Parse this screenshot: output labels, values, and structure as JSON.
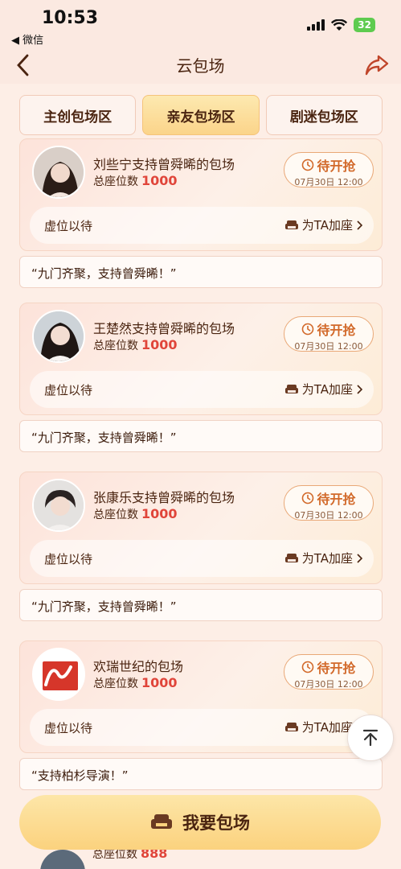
{
  "status": {
    "time": "10:53",
    "back_app": "◀ 微信",
    "battery": "32"
  },
  "nav": {
    "title": "云包场"
  },
  "tabs": [
    {
      "label": "主创包场区",
      "active": false
    },
    {
      "label": "亲友包场区",
      "active": true
    },
    {
      "label": "剧迷包场区",
      "active": false
    }
  ],
  "cards": [
    {
      "title": "刘些宁支持曾舜晞的包场",
      "seats_label": "总座位数",
      "seats": "1000",
      "status": "待开抢",
      "date": "07月30日 12:00",
      "waiting": "虚位以待",
      "action": "为TA加座",
      "slogan": "“九门齐聚，支持曾舜晞！”"
    },
    {
      "title": "王楚然支持曾舜晞的包场",
      "seats_label": "总座位数",
      "seats": "1000",
      "status": "待开抢",
      "date": "07月30日 12:00",
      "waiting": "虚位以待",
      "action": "为TA加座",
      "slogan": "“九门齐聚，支持曾舜晞！”"
    },
    {
      "title": "张康乐支持曾舜晞的包场",
      "seats_label": "总座位数",
      "seats": "1000",
      "status": "待开抢",
      "date": "07月30日 12:00",
      "waiting": "虚位以待",
      "action": "为TA加座",
      "slogan": "“九门齐聚，支持曾舜晞！”"
    },
    {
      "title": "欢瑞世纪的包场",
      "seats_label": "总座位数",
      "seats": "1000",
      "status": "待开抢",
      "date": "07月30日 12:00",
      "waiting": "虚位以待",
      "action": "为TA加座",
      "slogan": "“支持柏杉导演！”"
    }
  ],
  "peek": {
    "seats_label": "总座位数",
    "seats": "888"
  },
  "cta": {
    "label": "我要包场"
  },
  "colors": {
    "accent": "#e0453a",
    "status": "#d2692a",
    "cta": "#fbd27e"
  },
  "icons": [
    "back-arrow-icon",
    "share-icon",
    "clock-icon",
    "sofa-icon",
    "chevron-right-icon",
    "scroll-top-icon"
  ]
}
